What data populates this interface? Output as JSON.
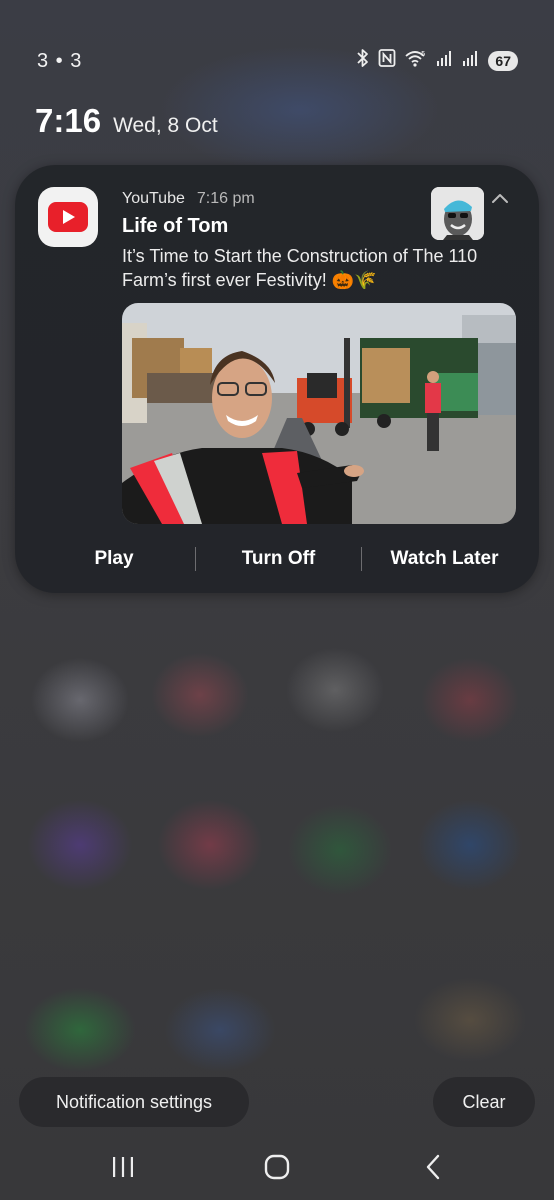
{
  "status_bar": {
    "left_text": "3 • 3",
    "battery_level": "67",
    "icons": [
      "bluetooth-icon",
      "nfc-icon",
      "wifi-icon",
      "signal-icon",
      "signal-icon",
      "battery-icon"
    ]
  },
  "lock_header": {
    "time": "7:16",
    "date": "Wed, 8 Oct"
  },
  "notification": {
    "app_icon": "youtube-icon",
    "app_name": "YouTube",
    "time": "7:16 pm",
    "title": "Life of Tom",
    "body": "It’s Time to Start the Construction of The 110 Farm’s first ever Festivity! 🎃🌾",
    "actions": {
      "play": "Play",
      "turn_off": "Turn Off",
      "watch_later": "Watch Later"
    },
    "colors": {
      "youtube_red": "#e8202a",
      "card_bg": "#222428"
    }
  },
  "footer": {
    "notification_settings": "Notification settings",
    "clear": "Clear"
  },
  "navigation": {
    "icons": [
      "recent-apps-icon",
      "home-icon",
      "back-icon"
    ]
  }
}
